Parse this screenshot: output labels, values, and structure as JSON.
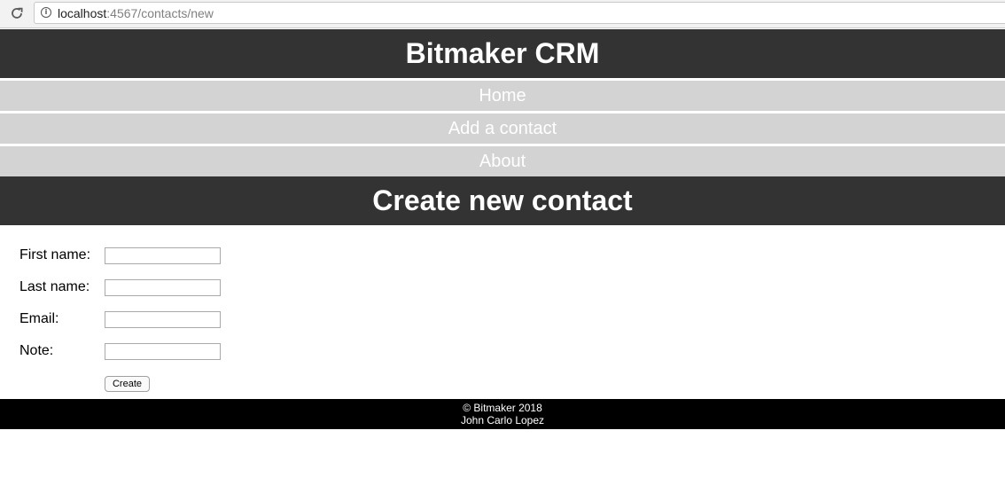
{
  "browser": {
    "url_host": "localhost",
    "url_rest": ":4567/contacts/new",
    "reload_icon": "reload-icon",
    "info_icon": "info-icon"
  },
  "header": {
    "title": "Bitmaker CRM"
  },
  "nav": {
    "items": [
      {
        "label": "Home"
      },
      {
        "label": "Add a contact"
      },
      {
        "label": "About"
      }
    ]
  },
  "main": {
    "heading": "Create new contact",
    "form": {
      "fields": [
        {
          "label": "First name:",
          "value": ""
        },
        {
          "label": "Last name:",
          "value": ""
        },
        {
          "label": "Email:",
          "value": ""
        },
        {
          "label": "Note:",
          "value": ""
        }
      ],
      "submit_label": "Create"
    }
  },
  "footer": {
    "copyright": "© Bitmaker 2018",
    "author": "John Carlo Lopez"
  },
  "colors": {
    "header_bg": "#333333",
    "nav_bg": "#d3d3d3",
    "footer_bg": "#000000",
    "text_on_dark": "#ffffff"
  }
}
